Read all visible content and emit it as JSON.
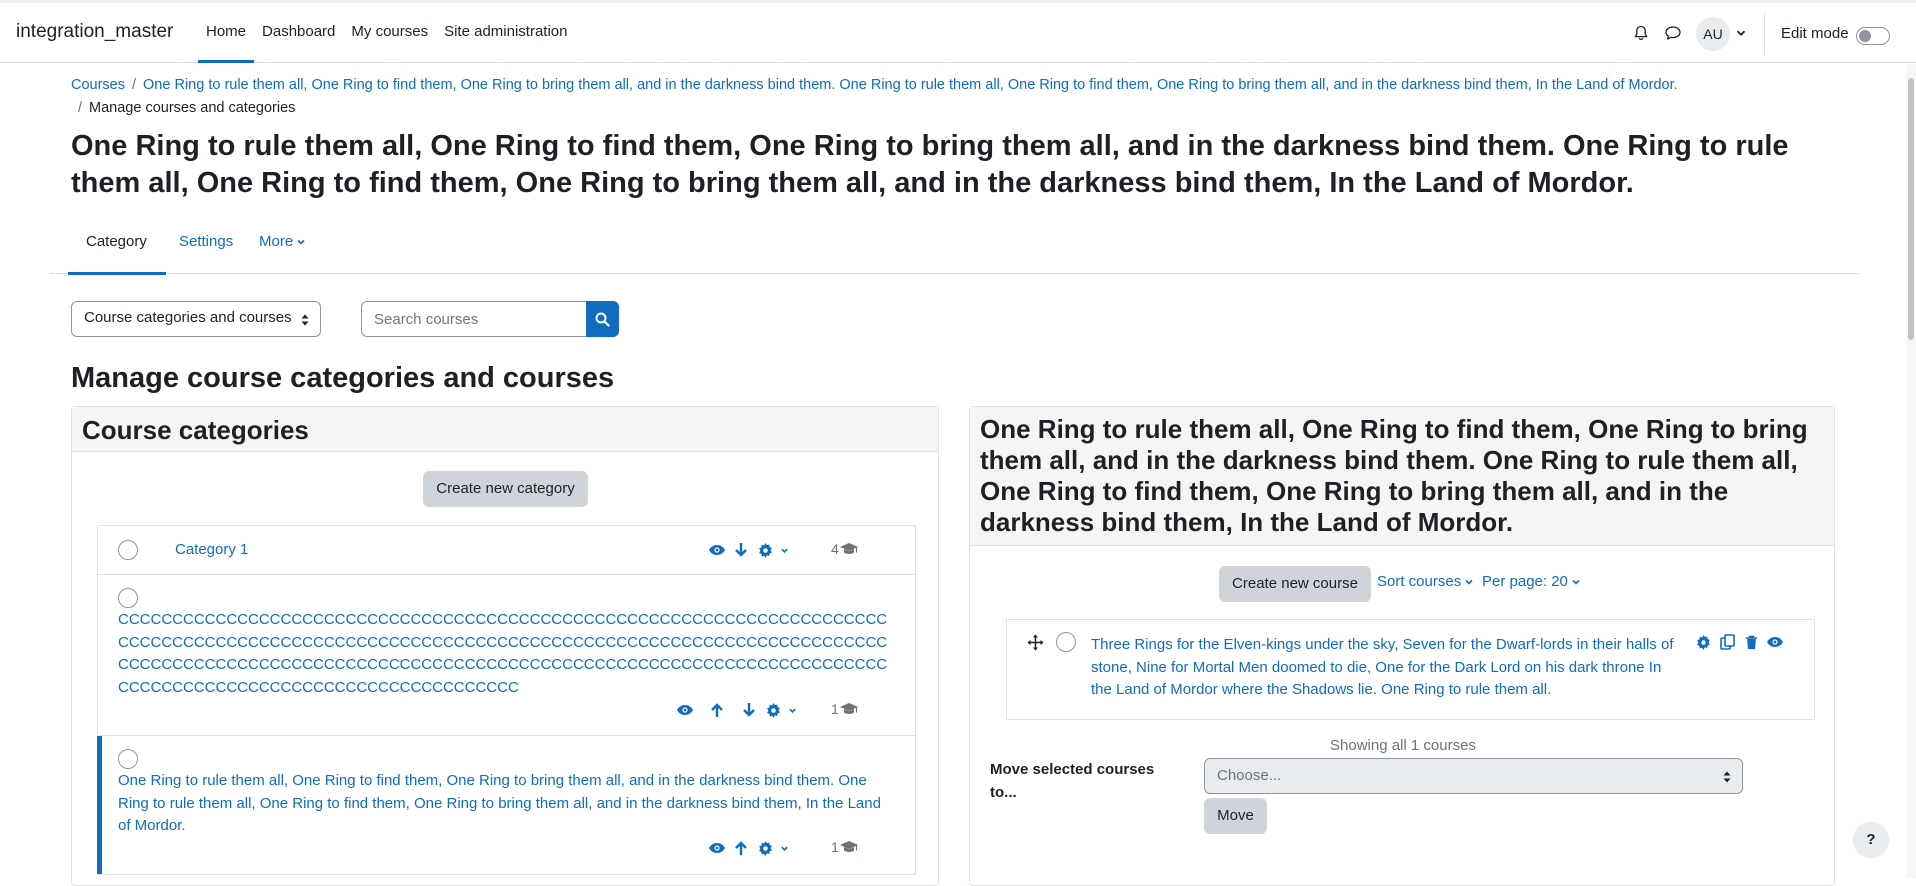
{
  "navbar": {
    "brand": "integration_master",
    "items": [
      {
        "label": "Home",
        "active": true
      },
      {
        "label": "Dashboard",
        "active": false
      },
      {
        "label": "My courses",
        "active": false
      },
      {
        "label": "Site administration",
        "active": false
      }
    ],
    "avatar_initials": "AU",
    "edit_mode_label": "Edit mode",
    "edit_mode_on": false
  },
  "breadcrumb": {
    "items": [
      "Courses",
      "One Ring to rule them all, One Ring to find them, One Ring to bring them all, and in the darkness bind them. One Ring to rule them all, One Ring to find them, One Ring to bring them all, and in the darkness bind them, In the Land of Mordor."
    ],
    "current": "Manage courses and categories"
  },
  "page_title": "One Ring to rule them all, One Ring to find them, One Ring to bring them all, and in the darkness bind them. One Ring to rule them all, One Ring to find them, One Ring to bring them all, and in the darkness bind them, In the Land of Mordor.",
  "secondary_nav": {
    "tabs": [
      "Category",
      "Settings",
      "More"
    ]
  },
  "controls": {
    "view_select": "Course categories and courses",
    "search_placeholder": "Search courses"
  },
  "section_title": "Manage course categories and courses",
  "categories_panel": {
    "title": "Course categories",
    "create_button": "Create new category",
    "rows": [
      {
        "name": "Category 1",
        "count": "4"
      },
      {
        "name": "CCCCCCCCCCCCCCCCCCCCCCCCCCCCCCCCCCCCCCCCCCCCCCCCCCCCCCCCCCCCCCCCCCCCCCCCCCCCCCCCCCCCCCCCCCCCCCCCCCCCCCCCCCCCCCCCCCCCCCCCCCCCCCCCCCCCCCCCCCCCCCCCCCCCCCCCCCCCCCCCCCCCCCCCCCCCCCCCCCCCCCCCCCCCCCCCCCCCCCCCCCCCCCCCCCCCCCCCCCCCCCCCCCCCCCCCCCCCCCCCCCCCCCCCCC",
        "count": "1"
      },
      {
        "name": "One Ring to rule them all, One Ring to find them, One Ring to bring them all, and in the darkness bind them. One Ring to rule them all, One Ring to find them, One Ring to bring them all, and in the darkness bind them, In the Land of Mordor.",
        "count": "1"
      }
    ]
  },
  "courses_panel": {
    "title": "One Ring to rule them all, One Ring to find them, One Ring to bring them all, and in the darkness bind them. One Ring to rule them all, One Ring to find them, One Ring to bring them all, and in the darkness bind them, In the Land of Mordor.",
    "create_button": "Create new course",
    "sort_label": "Sort courses",
    "per_page_label": "Per page: 20",
    "course_name": "Three Rings for the Elven-kings under the sky, Seven for the Dwarf-lords in their halls of stone, Nine for Mortal Men doomed to die, One for the Dark Lord on his dark throne In the Land of Mordor where the Shadows lie. One Ring to rule them all.",
    "showing": "Showing all 1 courses",
    "move_label": "Move selected courses to...",
    "move_placeholder": "Choose...",
    "move_button": "Move"
  },
  "help_button": "?",
  "colors": {
    "accent": "#0f6cbf",
    "muted": "#6a737b",
    "button_secondary": "#ced4da"
  }
}
